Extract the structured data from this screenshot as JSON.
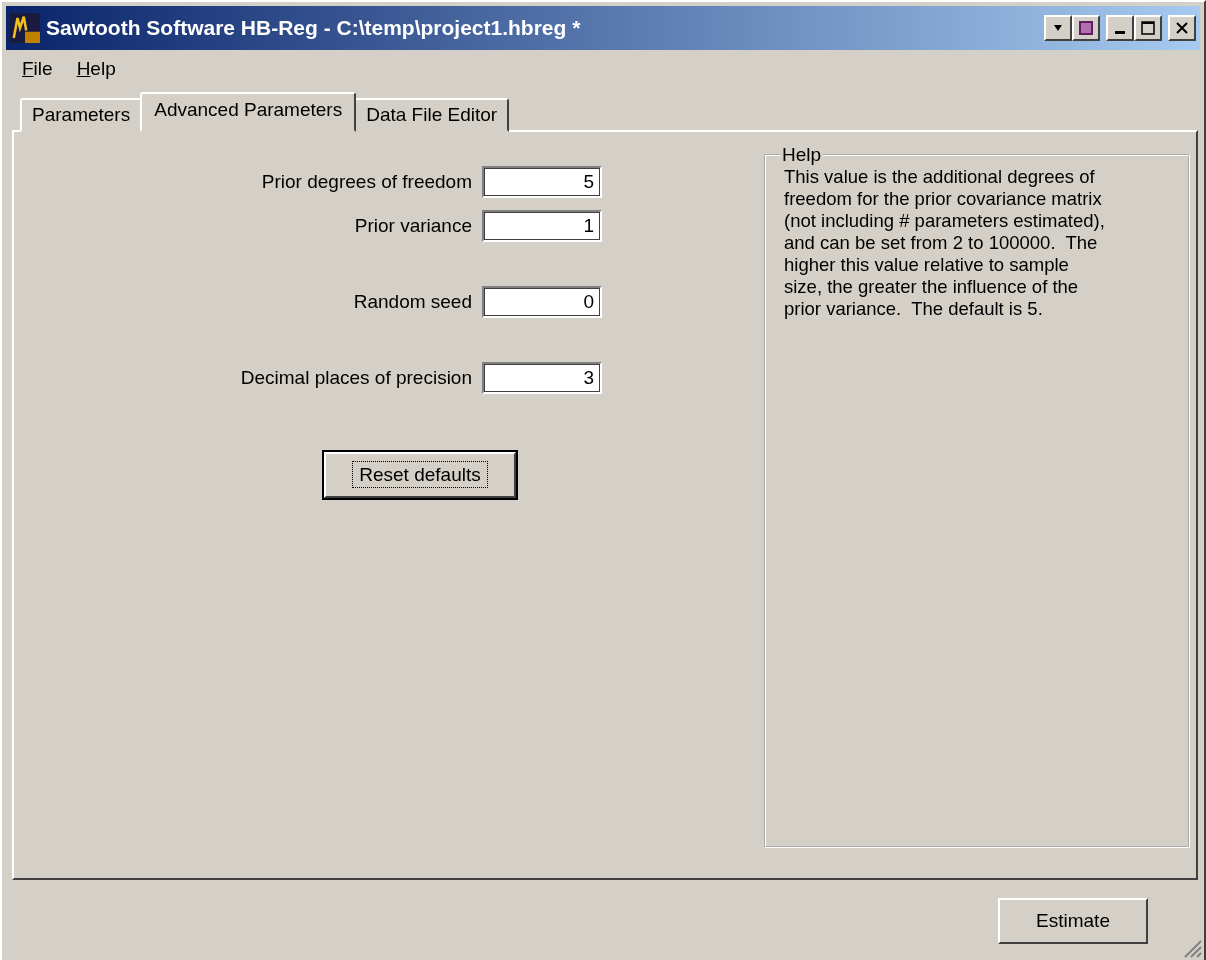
{
  "window": {
    "title": "Sawtooth Software HB-Reg - C:\\temp\\project1.hbreg *"
  },
  "menu": [
    "File",
    "Help"
  ],
  "tabs": [
    {
      "label": "Parameters",
      "selected": false
    },
    {
      "label": "Advanced Parameters",
      "selected": true
    },
    {
      "label": "Data File Editor",
      "selected": false
    }
  ],
  "field_groups": [
    {
      "fields": [
        {
          "label": "Prior degrees of freedom",
          "value": "5"
        },
        {
          "label": "Prior variance",
          "value": "1"
        }
      ]
    },
    {
      "fields": [
        {
          "label": "Random seed",
          "value": "0"
        }
      ]
    },
    {
      "fields": [
        {
          "label": "Decimal places of precision",
          "value": "3"
        }
      ]
    }
  ],
  "reset_button": "Reset defaults",
  "help": {
    "title": "Help",
    "text": "This value is the additional degrees of\nfreedom for the prior covariance matrix\n(not including # parameters estimated),\nand can be set from 2 to 100000.  The\nhigher this value relative to sample\nsize, the greater the influence of the\nprior variance.  The default is 5."
  },
  "estimate_button": "Estimate"
}
